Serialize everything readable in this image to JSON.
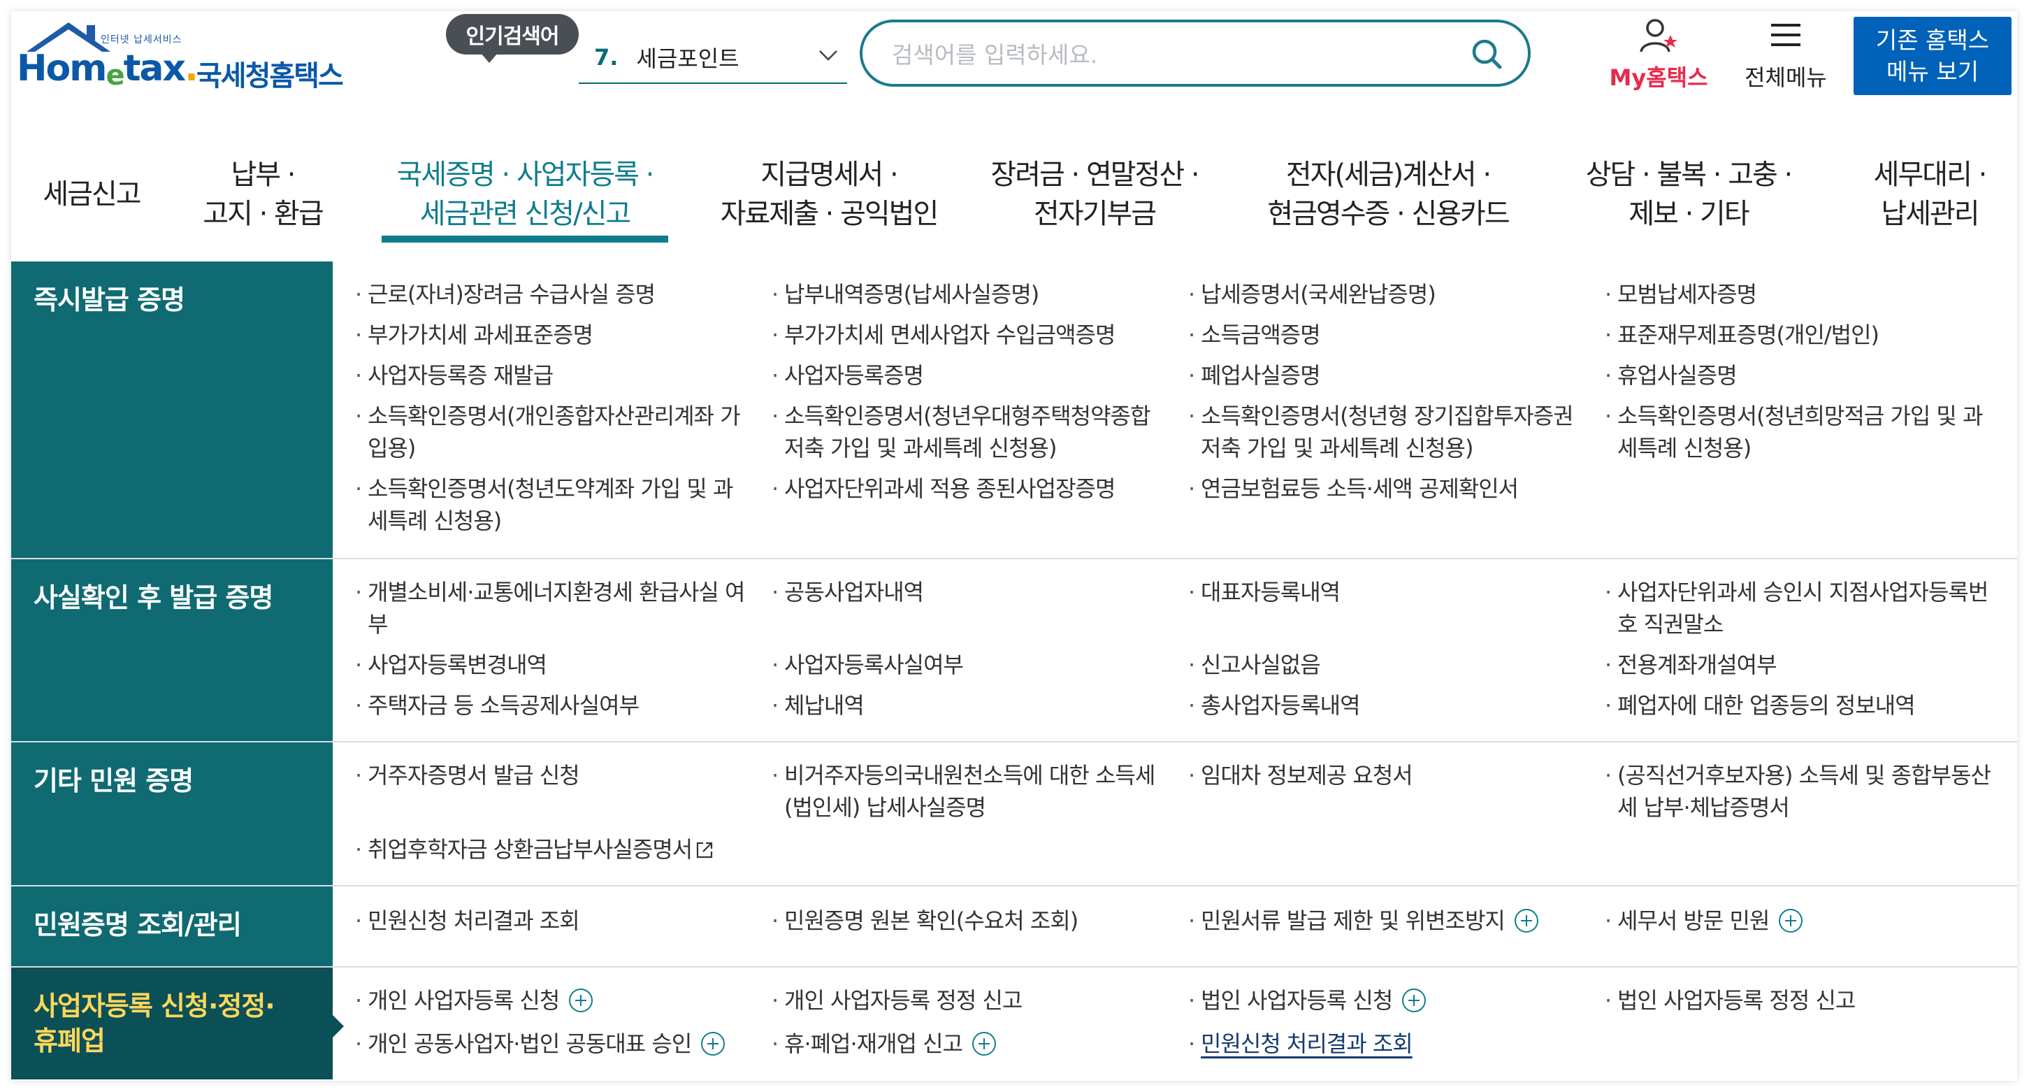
{
  "logo": {
    "tag": "인터넷 납세서비스",
    "word_home": "Hom",
    "word_e": "e",
    "word_tax": "tax",
    "word_dot": ".",
    "korean": "국세청홈택스"
  },
  "popular": {
    "badge": "인기검색어",
    "rank": "7.",
    "keyword": "세금포인트"
  },
  "search": {
    "placeholder": "검색어를 입력하세요."
  },
  "header": {
    "my_hometax": "My홈택스",
    "all_menu": "전체메뉴",
    "old_button_line1": "기존 홈택스",
    "old_button_line2": "메뉴 보기"
  },
  "nav": {
    "tabs": [
      {
        "label": "세금신고"
      },
      {
        "label": "납부 ·\n고지 · 환급"
      },
      {
        "label": "국세증명 · 사업자등록 ·\n세금관련 신청/신고",
        "active": true
      },
      {
        "label": "지급명세서 ·\n자료제출 · 공익법인"
      },
      {
        "label": "장려금 · 연말정산 ·\n전자기부금"
      },
      {
        "label": "전자(세금)계산서 ·\n현금영수증 · 신용카드"
      },
      {
        "label": "상담 · 불복 · 고충 ·\n제보 · 기타"
      },
      {
        "label": "세무대리 ·\n납세관리"
      }
    ]
  },
  "sections": [
    {
      "title": "즉시발급 증명",
      "items": [
        "근로(자녀)장려금 수급사실 증명",
        "납부내역증명(납세사실증명)",
        "납세증명서(국세완납증명)",
        "모범납세자증명",
        "부가가치세 과세표준증명",
        "부가가치세 면세사업자 수입금액증명",
        "소득금액증명",
        "표준재무제표증명(개인/법인)",
        "사업자등록증 재발급",
        "사업자등록증명",
        "폐업사실증명",
        "휴업사실증명",
        "소득확인증명서(개인종합자산관리계좌 가입용)",
        "소득확인증명서(청년우대형주택청약종합저축 가입 및 과세특례 신청용)",
        "소득확인증명서(청년형 장기집합투자증권저축 가입 및 과세특례 신청용)",
        "소득확인증명서(청년희망적금 가입 및 과세특례 신청용)",
        "소득확인증명서(청년도약계좌 가입 및 과세특례 신청용)",
        "사업자단위과세 적용 종된사업장증명",
        "연금보험료등 소득·세액 공제확인서"
      ]
    },
    {
      "title": "사실확인 후 발급 증명",
      "items": [
        "개별소비세·교통에너지환경세 환급사실 여부",
        "공동사업자내역",
        "대표자등록내역",
        "사업자단위과세 승인시 지점사업자등록번호 직권말소",
        "사업자등록변경내역",
        "사업자등록사실여부",
        "신고사실없음",
        "전용계좌개설여부",
        "주택자금 등 소득공제사실여부",
        "체납내역",
        "총사업자등록내역",
        "폐업자에 대한 업종등의 정보내역"
      ]
    },
    {
      "title": "기타 민원 증명",
      "items": [
        "거주자증명서 발급 신청",
        "비거주자등의국내원천소득에 대한 소득세(법인세) 납세사실증명",
        "임대차 정보제공 요청서",
        "(공직선거후보자용) 소득세 및 종합부동산세 납부·체납증명서",
        "취업후학자금 상환금납부사실증명서"
      ]
    },
    {
      "title": "민원증명 조회/관리",
      "items": [
        "민원신청 처리결과 조회",
        "민원증명 원본 확인(수요처 조회)",
        "민원서류 발급 제한 및 위변조방지",
        "세무서 방문 민원"
      ]
    },
    {
      "title": "사업자등록 신청·정정·\n휴폐업",
      "items": [
        "개인 사업자등록 신청",
        "개인 사업자등록 정정 신고",
        "법인 사업자등록 신청",
        "법인 사업자등록 정정 신고",
        "개인 공동사업자·법인 공동대표 승인",
        "휴·폐업·재개업 신고",
        "민원신청 처리결과 조회"
      ]
    }
  ],
  "colors": {
    "teal": "#0f6a72",
    "teal_dark": "#0b4f57",
    "accent": "#0f7d8c",
    "highlight": "#ffd75a",
    "brand_blue": "#0062b8",
    "my_red": "#e8294d"
  }
}
